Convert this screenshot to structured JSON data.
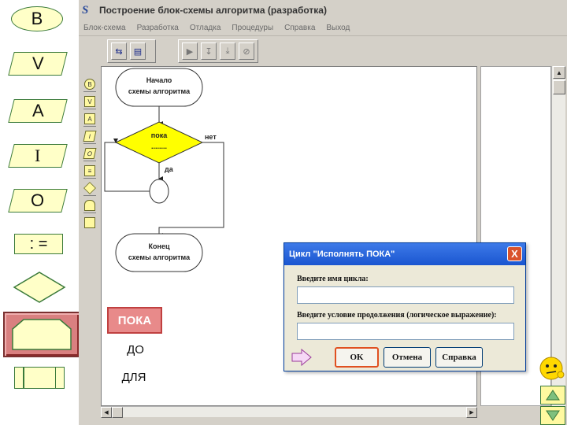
{
  "palette": {
    "begin": "B",
    "input": "V",
    "assign_a": "A",
    "io": "I",
    "output": "O",
    "assign": ": ="
  },
  "window": {
    "icon": "S",
    "title": "Построение блок-схемы алгоритма (разработка)"
  },
  "menu": [
    "Блок-схема",
    "Разработка",
    "Отладка",
    "Процедуры",
    "Справка",
    "Выход"
  ],
  "toolbar": {
    "group1": [
      "indent-icon",
      "save-icon"
    ],
    "group2": [
      "run-icon",
      "step-into-icon",
      "step-over-icon",
      "stop-icon"
    ]
  },
  "flowchart": {
    "start": [
      "Начало",
      "схемы алгоритма"
    ],
    "condition": [
      "пока",
      "........"
    ],
    "no_label": "нет",
    "yes_label": "да",
    "end": [
      "Конец",
      "схемы алгоритма"
    ]
  },
  "strip_labels": [
    "B",
    "V",
    "A",
    "I",
    "O"
  ],
  "loop_options": {
    "poka": "ПОКА",
    "do": "ДО",
    "dlya": "ДЛЯ"
  },
  "dialog": {
    "title": "Цикл \"Исполнять ПОКА\"",
    "close": "X",
    "name_label": "Введите имя цикла:",
    "name_value": "",
    "cond_label": "Введите условие продолжения (логическое выражение):",
    "cond_value": "",
    "ok": "OK",
    "cancel": "Отмена",
    "help": "Справка"
  },
  "colors": {
    "block_fill": "#ffffc8",
    "block_border": "#3a7a3a",
    "condition_fill": "#ffff00",
    "selected_loop": "#e88a8a",
    "dialog_title": "#1a55d0"
  }
}
